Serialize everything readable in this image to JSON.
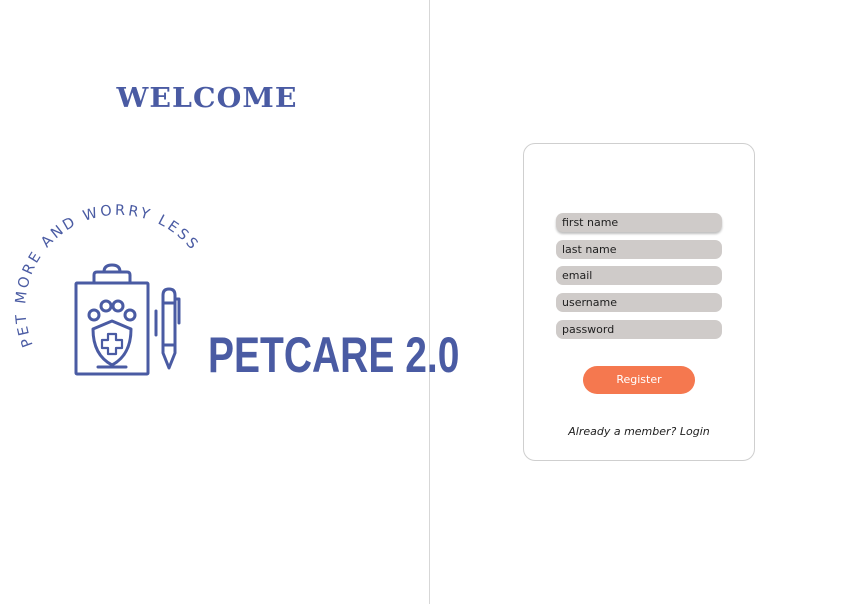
{
  "welcome": {
    "title": "WELCOME"
  },
  "brand": {
    "tagline": "PET MORE AND WORRY LESS",
    "name": "PETCARE 2.0",
    "color": "#4a5ba3"
  },
  "form": {
    "fields": [
      {
        "placeholder": "first name"
      },
      {
        "placeholder": "last name"
      },
      {
        "placeholder": "email"
      },
      {
        "placeholder": "username"
      },
      {
        "placeholder": "password"
      }
    ],
    "register_label": "Register",
    "register_color": "#f5784f",
    "login_prompt": "Already a member? Login"
  }
}
